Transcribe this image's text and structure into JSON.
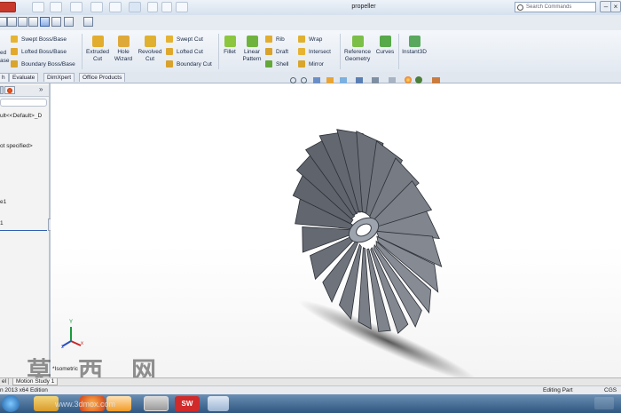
{
  "window": {
    "title": "propeller",
    "search_placeholder": "Search Commands",
    "minimize": "–",
    "close": "×"
  },
  "ribbon": {
    "left_cut": {
      "top": "ed",
      "bottom": "ase"
    },
    "boss": {
      "swept": "Swept Boss/Base",
      "lofted": "Lofted Boss/Base",
      "boundary": "Boundary Boss/Base"
    },
    "extruded_cut": "Extruded Cut",
    "hole_wizard": "Hole Wizard",
    "revolved_cut": "Revolved Cut",
    "cut": {
      "swept": "Swept Cut",
      "lofted": "Lofted Cut",
      "boundary": "Boundary Cut"
    },
    "fillet": "Fillet",
    "linear_pattern": "Linear Pattern",
    "features": {
      "rib": "Rib",
      "draft": "Draft",
      "shell": "Shell",
      "wrap": "Wrap",
      "intersect": "Intersect",
      "mirror": "Mirror"
    },
    "reference_geometry": "Reference Geometry",
    "curves": "Curves",
    "instant3d": "Instant3D"
  },
  "tabs": [
    "h",
    "Evaluate",
    "DimXpert",
    "Office Products"
  ],
  "left_panel": {
    "search_value": "",
    "items": [
      "ult<<Default>_D",
      "ot specified>",
      "e1",
      "1"
    ]
  },
  "viewport": {
    "view_label": "*Isometric"
  },
  "axes": {
    "x": "x",
    "y": "Y",
    "z": "z"
  },
  "bottom_tabs": [
    "el",
    "Motion Study 1"
  ],
  "status": {
    "left": "n 2013 x64 Edition",
    "mode": "Editing Part",
    "units": "CGS"
  },
  "watermark": {
    "chars": [
      "莫",
      "西",
      "网"
    ],
    "url": "www.3dmox.com"
  }
}
